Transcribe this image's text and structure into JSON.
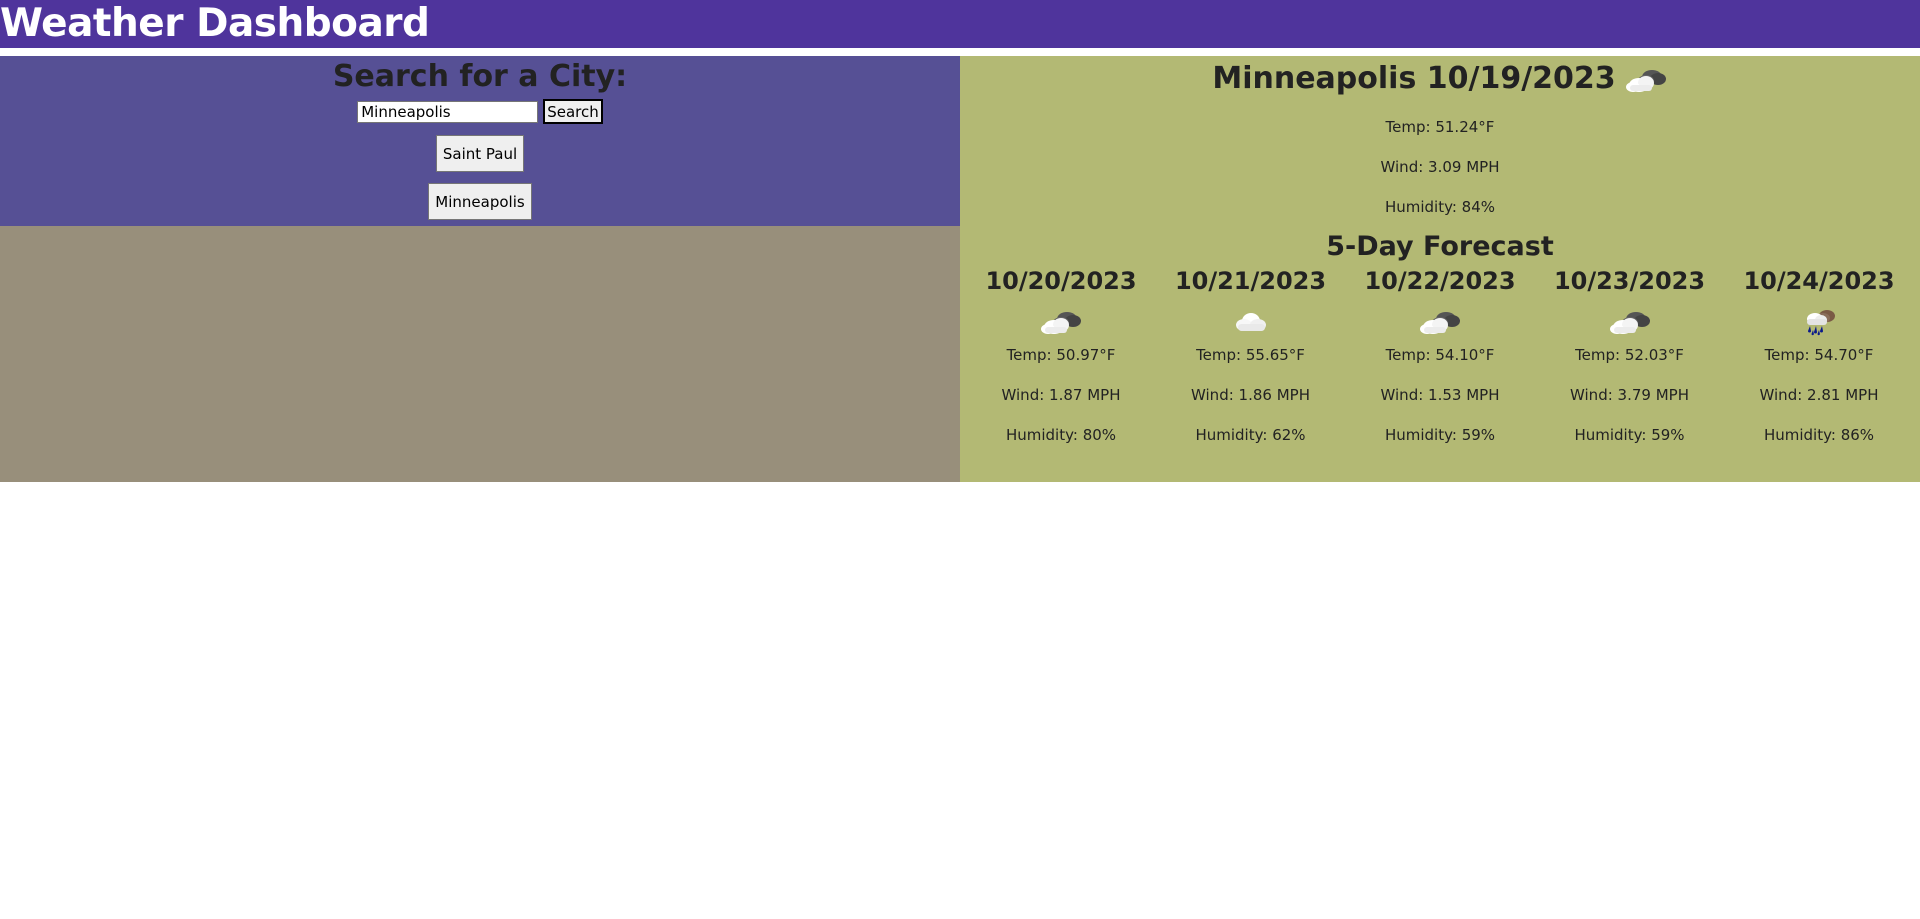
{
  "app": {
    "title": "Weather Dashboard"
  },
  "search": {
    "heading": "Search for a City:",
    "input_value": "Minneapolis",
    "button_label": "Search",
    "history": [
      "Saint Paul",
      "Minneapolis"
    ]
  },
  "colors": {
    "header": "#4f349c",
    "search_panel": "#565095",
    "empty_panel": "#988f7b",
    "weather_panel": "#b3b974"
  },
  "current": {
    "title": "Minneapolis 10/19/2023",
    "icon": "broken-clouds-icon",
    "temp": "Temp: 51.24°F",
    "wind": "Wind: 3.09 MPH",
    "humidity": "Humidity: 84%"
  },
  "forecast": {
    "heading": "5-Day Forecast",
    "days": [
      {
        "date": "10/20/2023",
        "icon": "broken-clouds-icon",
        "temp": "Temp: 50.97°F",
        "wind": "Wind: 1.87 MPH",
        "humidity": "Humidity: 80%"
      },
      {
        "date": "10/21/2023",
        "icon": "cloud-icon",
        "temp": "Temp: 55.65°F",
        "wind": "Wind: 1.86 MPH",
        "humidity": "Humidity: 62%"
      },
      {
        "date": "10/22/2023",
        "icon": "broken-clouds-icon",
        "temp": "Temp: 54.10°F",
        "wind": "Wind: 1.53 MPH",
        "humidity": "Humidity: 59%"
      },
      {
        "date": "10/23/2023",
        "icon": "broken-clouds-icon",
        "temp": "Temp: 52.03°F",
        "wind": "Wind: 3.79 MPH",
        "humidity": "Humidity: 59%"
      },
      {
        "date": "10/24/2023",
        "icon": "rain-icon",
        "temp": "Temp: 54.70°F",
        "wind": "Wind: 2.81 MPH",
        "humidity": "Humidity: 86%"
      }
    ]
  }
}
